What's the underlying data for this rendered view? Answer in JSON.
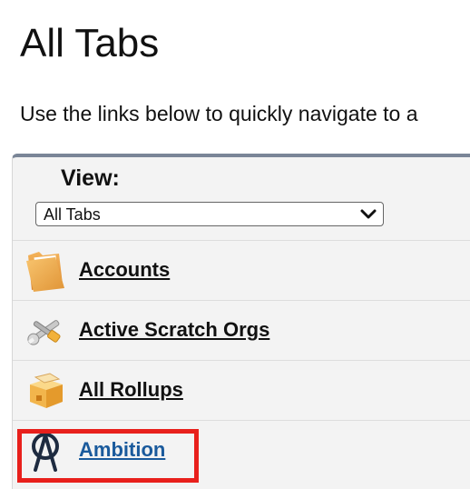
{
  "page": {
    "title": "All Tabs",
    "intro": "Use the links below to quickly navigate to a"
  },
  "view": {
    "label": "View:",
    "selected": "All Tabs"
  },
  "tabs": [
    {
      "label": "Accounts",
      "icon": "folder-icon"
    },
    {
      "label": "Active Scratch Orgs",
      "icon": "tools-icon"
    },
    {
      "label": "All Rollups",
      "icon": "box-icon"
    },
    {
      "label": "Ambition",
      "icon": "ambition-logo-icon",
      "highlighted": true
    }
  ],
  "colors": {
    "highlight": "#e8201c",
    "link_blue": "#1a5a9c",
    "panel_border": "#7a8597"
  }
}
